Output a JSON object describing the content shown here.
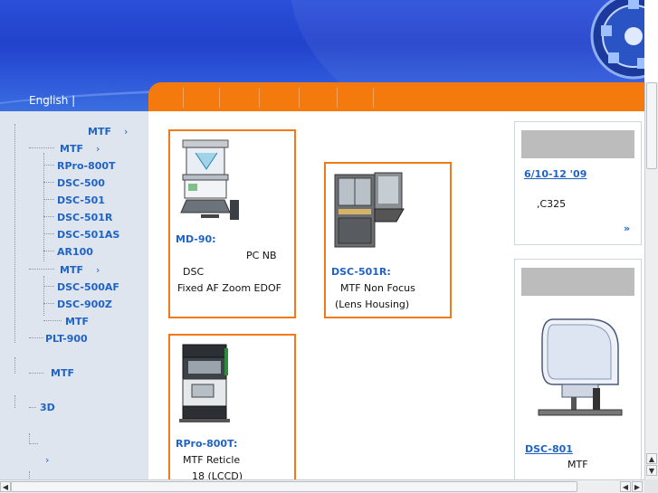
{
  "header": {
    "language_link": "English |",
    "colors": {
      "banner": "#2242cc",
      "menu_bar": "#f47a0e"
    },
    "menu_items": [
      "",
      "",
      "",
      "",
      "",
      ""
    ]
  },
  "sidebar": {
    "items": [
      {
        "label": "MTF",
        "arrow": "›"
      },
      {
        "label": "MTF",
        "arrow": "›"
      },
      {
        "label": "RPro-800T"
      },
      {
        "label": "DSC-500"
      },
      {
        "label": "DSC-501"
      },
      {
        "label": "DSC-501R"
      },
      {
        "label": "DSC-501AS"
      },
      {
        "label": "AR100"
      },
      {
        "label": "MTF",
        "arrow": "›"
      },
      {
        "label": "DSC-500AF"
      },
      {
        "label": "DSC-900Z"
      },
      {
        "label": "MTF"
      },
      {
        "label": "PLT-900"
      },
      {
        "label": "MTF"
      },
      {
        "label": "3D"
      },
      {
        "label": "",
        "arrow": "›"
      }
    ]
  },
  "products": [
    {
      "title": "MD-90:",
      "lines": [
        "PC NB",
        "DSC",
        "Fixed AF Zoom EDOF"
      ],
      "image_icon": "md90-machine-icon"
    },
    {
      "title": "DSC-501R:",
      "lines": [
        "MTF        Non Focus",
        "(Lens Housing)"
      ],
      "image_icon": "dsc501r-machine-icon"
    },
    {
      "title": "RPro-800T:",
      "lines": [
        "MTF                  Reticle",
        "18      (LCCD)"
      ],
      "image_icon": "rpro800t-machine-icon"
    }
  ],
  "news": {
    "date_link": "6/10-12 '09",
    "text": ",C325",
    "more": "»"
  },
  "featured": {
    "link": "DSC-801",
    "text": "MTF",
    "image_icon": "dsc801-machine-icon"
  },
  "scrollbars": {
    "up": "▲",
    "down": "▼",
    "left": "◀",
    "right": "▶"
  }
}
